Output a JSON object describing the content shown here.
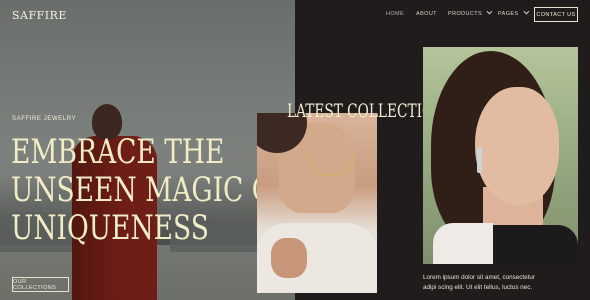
{
  "brand": "SAFFIRE",
  "nav": {
    "home": "HOME",
    "about": "ABOUT",
    "products": "PRODUCTS",
    "pages": "PAGES",
    "contact": "CONTACT US"
  },
  "hero": {
    "eyebrow": "SAFFIRE JEWELRY",
    "headline_lines": [
      "EMBRACE THE",
      "UNSEEN MAGIC OF",
      "UNIQUENESS"
    ],
    "cta": "OUR COLLECTIONS"
  },
  "collections": {
    "title": "LATEST COLLECTIONS",
    "description_lines": [
      "Lorem ipsum dolor sit amet, consectetur",
      "adipi scing elit. Ut elit tellus, luctus nec."
    ]
  },
  "colors": {
    "accent_text": "#f1ebc6",
    "dark_bg": "#1f1c1b"
  }
}
